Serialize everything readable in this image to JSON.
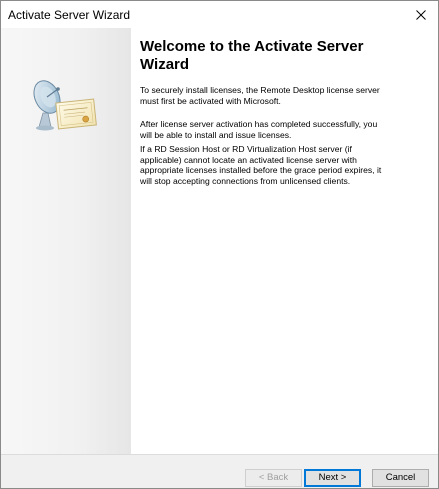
{
  "window": {
    "title": "Activate Server Wizard"
  },
  "content": {
    "heading": "Welcome to the Activate Server Wizard",
    "paragraphs": [
      "To securely install licenses, the Remote Desktop license server must first be activated with Microsoft.",
      "After license server activation has completed successfully, you will be able to install and issue licenses.",
      "If a RD Session Host or RD Virtualization Host server (if applicable) cannot locate an activated license server with appropriate licenses installed before the grace period expires, it will stop accepting connections from unlicensed clients."
    ]
  },
  "buttons": {
    "back": "< Back",
    "next": "Next >",
    "cancel": "Cancel"
  },
  "icons": {
    "close": "close-icon",
    "wizard_art": "satellite-certificate-icon"
  },
  "colors": {
    "accent": "#0078d7",
    "panel_bg": "#f0f0f0",
    "content_bg": "#ffffff"
  }
}
